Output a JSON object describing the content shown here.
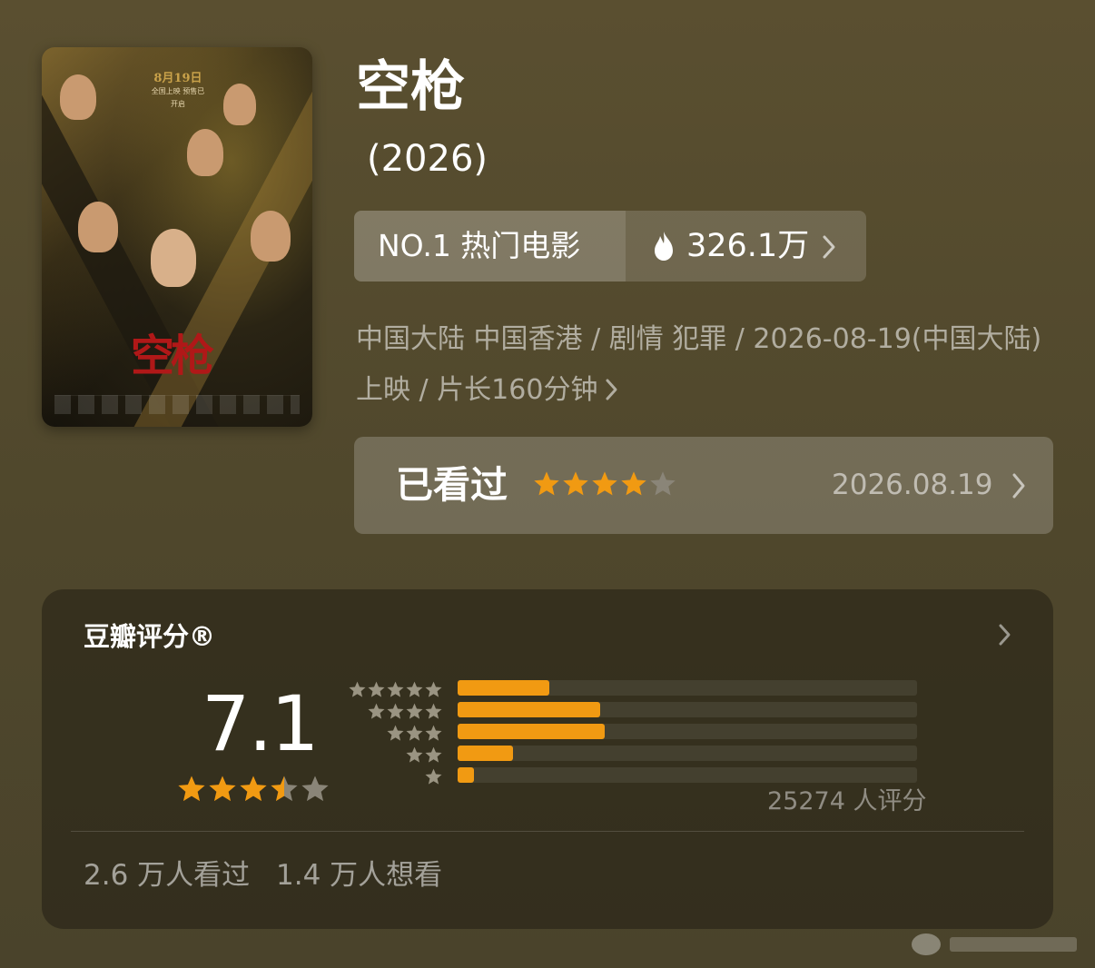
{
  "movie": {
    "title": "空枪",
    "year": "(2026)",
    "poster": {
      "date": "8月19日",
      "tagline": "全国上映 预售已开启",
      "title": "空枪"
    },
    "rank_label": "NO.1 热门电影",
    "heat": "326.1万",
    "meta": "中国大陆 中国香港 / 剧情 犯罪 / 2026-08-19(中国大陆) 上映 / 片长160分钟",
    "watched": {
      "label": "已看过",
      "stars": 4,
      "date": "2026.08.19"
    }
  },
  "rating": {
    "heading": "豆瓣评分®",
    "score": "7.1",
    "score_stars": 3.5,
    "distribution": [
      {
        "stars": 5,
        "fraction": 0.2
      },
      {
        "stars": 4,
        "fraction": 0.31
      },
      {
        "stars": 3,
        "fraction": 0.32
      },
      {
        "stars": 2,
        "fraction": 0.12
      },
      {
        "stars": 1,
        "fraction": 0.035
      }
    ],
    "count": "25274 人评分",
    "watched_count": "2.6 万人看过",
    "want_count": "1.4 万人想看"
  },
  "colors": {
    "accent": "#f19a12",
    "star_empty": "#8a8578"
  }
}
